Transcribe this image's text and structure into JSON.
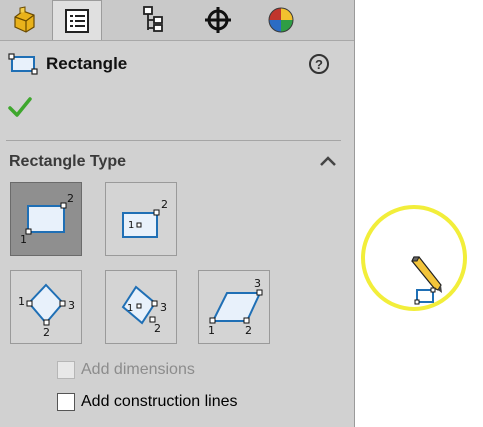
{
  "tabs": [
    {
      "icon": "feature-manager-icon",
      "active": false
    },
    {
      "icon": "property-manager-icon",
      "active": true
    },
    {
      "icon": "configuration-manager-icon",
      "active": false
    },
    {
      "icon": "dimxpert-icon",
      "active": false
    },
    {
      "icon": "display-manager-icon",
      "active": false
    }
  ],
  "header": {
    "title": "Rectangle",
    "help_label": "?"
  },
  "section": {
    "title": "Rectangle Type"
  },
  "rect_types": [
    {
      "name": "corner-rectangle",
      "selected": true
    },
    {
      "name": "center-rectangle",
      "selected": false
    },
    {
      "name": "3-point-corner-rectangle",
      "selected": false
    },
    {
      "name": "3-point-center-rectangle",
      "selected": false
    },
    {
      "name": "parallelogram",
      "selected": false
    }
  ],
  "options": {
    "add_dimensions": {
      "label": "Add dimensions",
      "checked": false,
      "enabled": false
    },
    "add_construction_lines": {
      "label": "Add construction lines",
      "checked": false,
      "enabled": true
    }
  },
  "colors": {
    "panel": "#d1d1d1",
    "accent_green": "#3ea72d",
    "cursor_ring": "#f2ee3a",
    "sketch_blue": "#1f6fb5"
  }
}
